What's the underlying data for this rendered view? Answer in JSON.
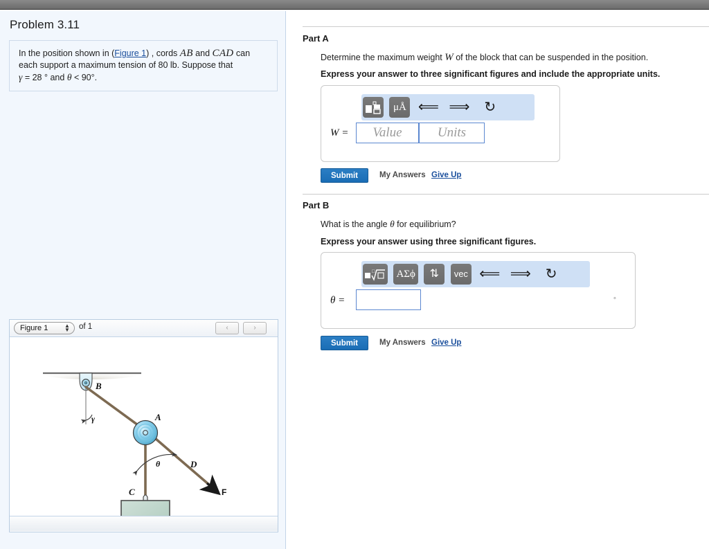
{
  "problem": {
    "title": "Problem 3.11",
    "statement_line1_pre": "In the position shown in (",
    "statement_figure_link": "Figure 1",
    "statement_line1_mid": ") , cords ",
    "statement_ab": "AB",
    "statement_and": " and ",
    "statement_cad": "CAD",
    "statement_line1_post": " can",
    "statement_line2": "each support a maximum tension of 80 lb. Suppose that",
    "statement_gamma": "γ",
    "statement_gamma_val": "= 28",
    "statement_deg1": "°",
    "statement_and2": "and",
    "statement_theta": "θ",
    "statement_theta_rel": "< 90",
    "statement_deg2": "°",
    "statement_period": "."
  },
  "figure": {
    "selected": "Figure 1",
    "of_label": "of 1",
    "prev_icon": "‹",
    "next_icon": "›",
    "stepper_icon": "⬍",
    "labels": {
      "b": "B",
      "a": "A",
      "c": "C",
      "d": "D",
      "f": "F",
      "gamma": "γ",
      "theta": "θ"
    },
    "colors": {
      "cord": "#7d6a52",
      "pulley_fill": "#8fd2ee",
      "bracket_fill": "#d7eef8",
      "block_fill": "#b9d3c8",
      "ceiling": "#6d6d6d"
    }
  },
  "partA": {
    "label": "Part A",
    "question": "Determine the maximum weight ",
    "question_var": "W",
    "question_rest": " of the block that can be suspended in the position.",
    "instruction": "Express your answer to three significant figures and include the appropriate units.",
    "toolbar": [
      {
        "name": "template-blocks-icon",
        "glyph": "■",
        "type": "button"
      },
      {
        "name": "units-icon",
        "glyph": "μÅ",
        "type": "button"
      },
      {
        "name": "undo-icon",
        "glyph": "↶",
        "type": "icon"
      },
      {
        "name": "redo-icon",
        "glyph": "↷",
        "type": "icon"
      },
      {
        "name": "reset-icon",
        "glyph": "↻",
        "type": "icon"
      },
      {
        "name": "keyboard-icon",
        "glyph": "⌨",
        "type": "icon"
      },
      {
        "name": "help-icon",
        "glyph": "?",
        "type": "icon"
      }
    ],
    "eq_label": "W =",
    "value_placeholder": "Value",
    "units_placeholder": "Units",
    "value_text": "",
    "units_text": "",
    "submit_label": "Submit",
    "my_answers_label": "My Answers",
    "give_up_label": "Give Up"
  },
  "partB": {
    "label": "Part B",
    "question_pre": "What is the angle ",
    "question_var": "θ",
    "question_post": " for equilibrium?",
    "instruction": "Express your answer using three significant figures.",
    "toolbar": [
      {
        "name": "nth-root-icon",
        "glyph": "√",
        "type": "button"
      },
      {
        "name": "greek-letters-icon",
        "glyph": "ΑΣϕ",
        "type": "button"
      },
      {
        "name": "arrows-updown-icon",
        "glyph": "⇅",
        "type": "button"
      },
      {
        "name": "vector-icon",
        "glyph": "vec",
        "type": "button"
      },
      {
        "name": "undo-icon",
        "glyph": "↶",
        "type": "icon"
      },
      {
        "name": "redo-icon",
        "glyph": "↷",
        "type": "icon"
      },
      {
        "name": "reset-icon",
        "glyph": "↻",
        "type": "icon"
      },
      {
        "name": "keyboard-icon",
        "glyph": "⌨",
        "type": "icon"
      },
      {
        "name": "help-icon",
        "glyph": "?",
        "type": "icon"
      }
    ],
    "eq_label": "θ =",
    "answer_text": "",
    "degree_symbol": "◦",
    "submit_label": "Submit",
    "my_answers_label": "My Answers",
    "give_up_label": "Give Up"
  }
}
